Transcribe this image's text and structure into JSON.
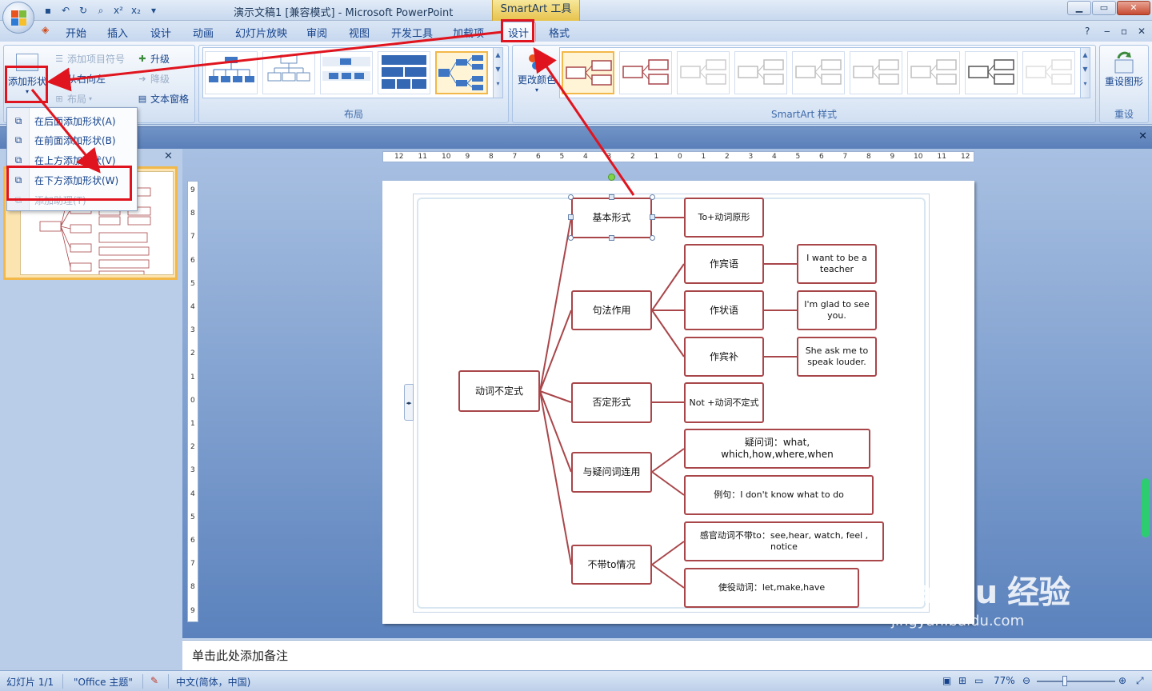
{
  "window": {
    "title": "演示文稿1 [兼容模式] - Microsoft PowerPoint",
    "contextual_tool": "SmartArt 工具"
  },
  "tabs": [
    {
      "label": "开始"
    },
    {
      "label": "插入"
    },
    {
      "label": "设计"
    },
    {
      "label": "动画"
    },
    {
      "label": "幻灯片放映"
    },
    {
      "label": "审阅"
    },
    {
      "label": "视图"
    },
    {
      "label": "开发工具"
    },
    {
      "label": "加载项"
    },
    {
      "label": "设计"
    },
    {
      "label": "格式"
    }
  ],
  "ribbon": {
    "create_graphic": {
      "add_shape": "添加形状",
      "add_bullet": "添加项目符号",
      "right_to_left": "从右向左",
      "layout": "布局",
      "promote": "升级",
      "demote": "降级",
      "text_pane": "文本窗格"
    },
    "layouts_label": "布局",
    "change_colors": "更改颜色",
    "styles_label": "SmartArt 样式",
    "reset_graphic": "重设图形",
    "reset_label": "重设"
  },
  "dropdown": {
    "items": [
      {
        "label": "在后面添加形状(A)"
      },
      {
        "label": "在前面添加形状(B)"
      },
      {
        "label": "在上方添加形状(V)"
      },
      {
        "label": "在下方添加形状(W)"
      },
      {
        "label": "添加助理(T)"
      }
    ]
  },
  "diagram": {
    "root": "动词不定式",
    "l1": [
      "基本形式",
      "句法作用",
      "否定形式",
      "与疑问词连用",
      "不带to情况"
    ],
    "l2": [
      "To+动词原形",
      "作宾语",
      "作状语",
      "作宾补",
      "Not +动词不定式",
      "疑问词：what, which,how,where,when",
      "例句：I don't know what to  do",
      "感官动词不带to：see,hear, watch, feel , notice",
      "使役动词：let,make,have"
    ],
    "l3": [
      "I want to be a teacher",
      "I'm glad to see you.",
      "She ask me to speak louder."
    ]
  },
  "notes_placeholder": "单击此处添加备注",
  "status": {
    "slide": "幻灯片 1/1",
    "theme": "\"Office 主题\"",
    "language": "中文(简体，中国)",
    "zoom": "77%"
  },
  "ruler": {
    "h_ticks": [
      "12",
      "11",
      "10",
      "9",
      "8",
      "7",
      "6",
      "5",
      "4",
      "3",
      "2",
      "1",
      "0",
      "1",
      "2",
      "3",
      "4",
      "5",
      "6",
      "7",
      "8",
      "9",
      "10",
      "11",
      "12"
    ],
    "v_ticks": [
      "9",
      "8",
      "7",
      "6",
      "5",
      "4",
      "3",
      "2",
      "1",
      "0",
      "1",
      "2",
      "3",
      "4",
      "5",
      "6",
      "7",
      "8",
      "9"
    ]
  },
  "watermark": {
    "brand": "Bai du 经验",
    "url": "jingyan.baidu.com"
  },
  "colors": {
    "node_border": "#a9464a",
    "annotation_red": "#e0141e",
    "ribbon_bg": "#dbe6f4",
    "infobar": "#5a7fb9"
  }
}
